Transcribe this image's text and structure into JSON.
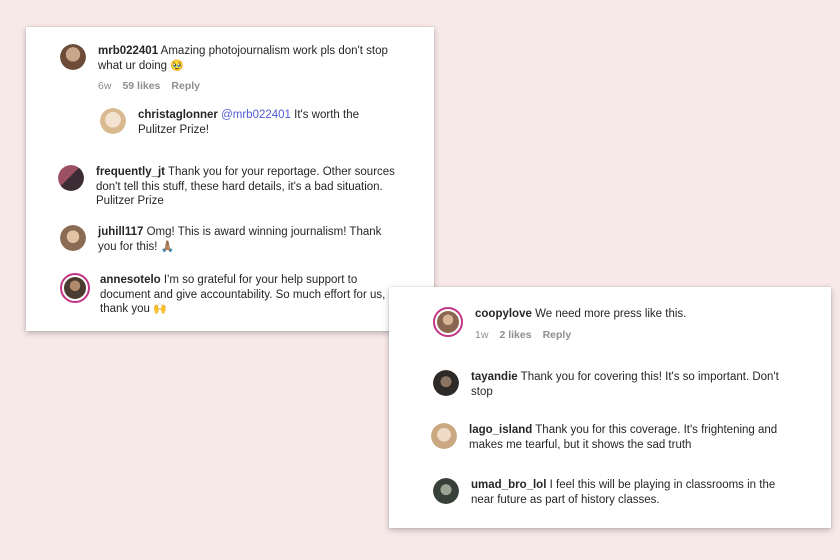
{
  "card_a": {
    "comments": [
      {
        "username": "mrb022401",
        "text": "Amazing photojournalism work pls don't stop what ur doing",
        "emoji": "🥹",
        "time": "6w",
        "likes": "59 likes",
        "reply": "Reply",
        "avatar_color": "#8a6a55"
      },
      {
        "username": "christaglonner",
        "mention": "@mrb022401",
        "text": "It's worth the Pulitzer Prize!",
        "avatar_color": "#e7d6c4"
      },
      {
        "username": "frequently_jt",
        "text": "Thank you for your reportage. Other sources don't tell this stuff, these hard details, it's a bad situation. Pulitzer Prize",
        "avatar_color": "#7a4052"
      },
      {
        "username": "juhill117",
        "text": "Omg! This is award winning journalism! Thank you for this!",
        "emoji": "🙏🏽",
        "avatar_color": "#b08a6e"
      },
      {
        "username": "annesotelo",
        "text": "I'm so grateful for your help support to document and give accountability. So much effort for us, thank you",
        "emoji": "🙌",
        "avatar_color": "#5a4a3c"
      }
    ]
  },
  "card_b": {
    "comments": [
      {
        "username": "coopylove",
        "text": "We need more press like this.",
        "time": "1w",
        "likes": "2 likes",
        "reply": "Reply",
        "avatar_color": "#9a7a64"
      },
      {
        "username": "tayandie",
        "text": "Thank you for covering this! It's so important. Don't stop",
        "avatar_color": "#3f3a36"
      },
      {
        "username": "lago_island",
        "text": "Thank you for this coverage. It's frightening and makes me tearful, but it shows the sad truth",
        "avatar_color": "#d8bca0"
      },
      {
        "username": "umad_bro_lol",
        "text": "I feel this will be playing in classrooms in the near future as part of history classes.",
        "avatar_color": "#4c554a"
      }
    ]
  },
  "colors": {
    "background": "#f8e9e9",
    "story_ring": "#c13584",
    "mention": "#4f5bd5",
    "meta_text": "#8e8e8e"
  }
}
